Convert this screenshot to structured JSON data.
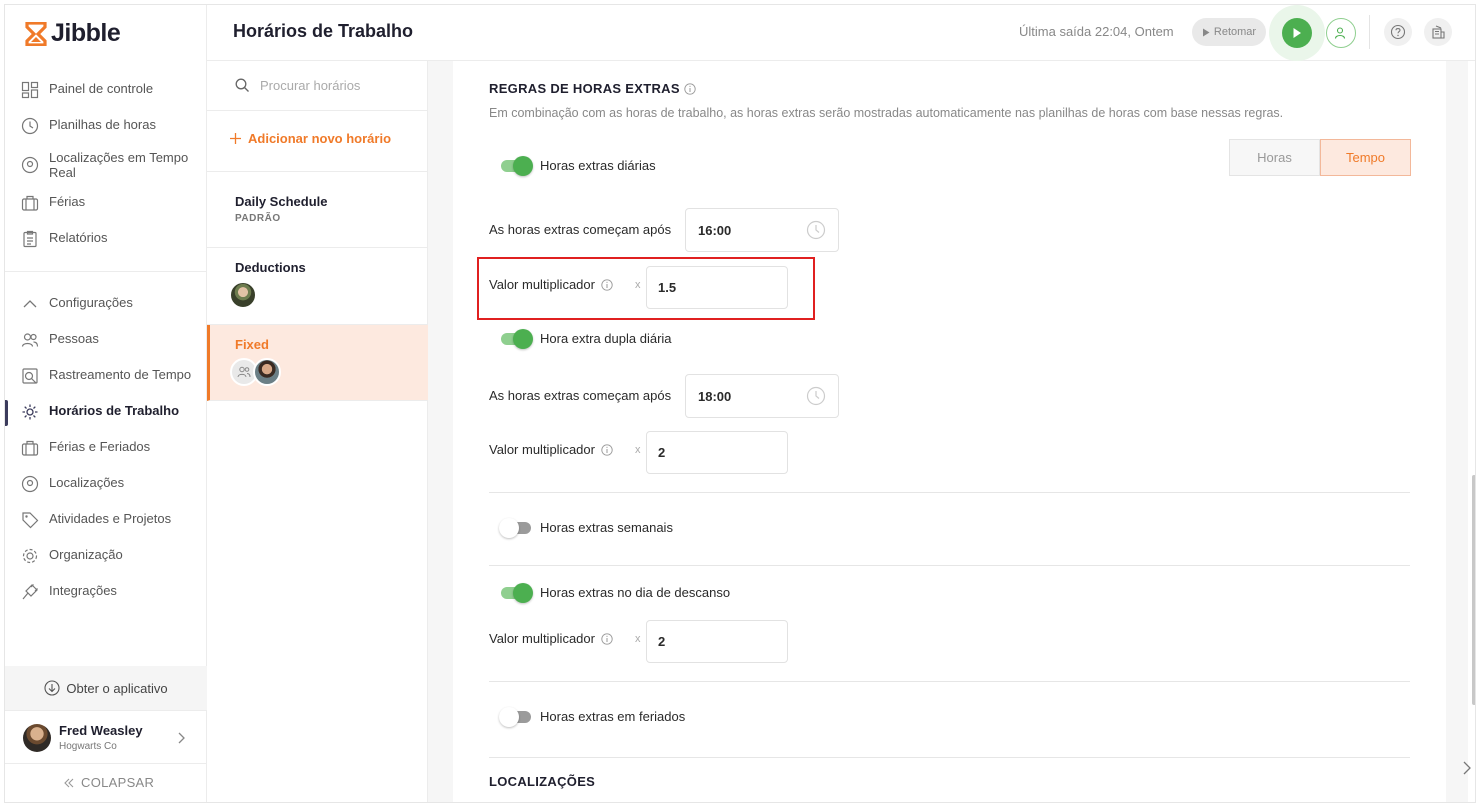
{
  "app": {
    "logo": "Jibble",
    "brand_color": "#f07a29",
    "accent_green": "#4caf50"
  },
  "sidebar": {
    "items": [
      {
        "label": "Painel de controle",
        "icon": "dashboard-icon"
      },
      {
        "label": "Planilhas de horas",
        "icon": "clock-icon"
      },
      {
        "label": "Localizações em Tempo Real",
        "icon": "location-pin-icon"
      },
      {
        "label": "Férias",
        "icon": "suitcase-icon"
      },
      {
        "label": "Relatórios",
        "icon": "clipboard-icon"
      }
    ],
    "settings_header": "Configurações",
    "settings_items": [
      {
        "label": "Pessoas",
        "icon": "people-icon"
      },
      {
        "label": "Rastreamento de Tempo",
        "icon": "time-tracking-icon"
      },
      {
        "label": "Horários de Trabalho",
        "icon": "schedule-gear-icon",
        "active": true
      },
      {
        "label": "Férias e Feriados",
        "icon": "suitcase-icon"
      },
      {
        "label": "Localizações",
        "icon": "location-pin-icon"
      },
      {
        "label": "Atividades e Projetos",
        "icon": "tag-icon"
      },
      {
        "label": "Organização",
        "icon": "gear-icon"
      },
      {
        "label": "Integrações",
        "icon": "plug-icon"
      }
    ],
    "get_app": "Obter o aplicativo",
    "user": {
      "name": "Fred Weasley",
      "org": "Hogwarts Co"
    },
    "collapse": "COLAPSAR"
  },
  "header": {
    "title": "Horários de Trabalho",
    "last_out": "Última saída 22:04, Ontem",
    "resume": "Retomar"
  },
  "schedules": {
    "search_placeholder": "Procurar horários",
    "add_new": "Adicionar novo horário",
    "items": [
      {
        "name": "Daily Schedule",
        "sub": "PADRÃO"
      },
      {
        "name": "Deductions"
      },
      {
        "name": "Fixed",
        "selected": true
      }
    ]
  },
  "overtime": {
    "title": "REGRAS DE HORAS EXTRAS",
    "description": "Em combinação com as horas de trabalho, as horas extras serão mostradas automaticamente nas planilhas de horas com base nessas regras.",
    "mode": {
      "options": [
        "Horas",
        "Tempo"
      ],
      "selected": "Tempo"
    },
    "daily": {
      "label": "Horas extras diárias",
      "enabled": true,
      "starts_after_label": "As horas extras começam após",
      "starts_after": "16:00",
      "multiplier_label": "Valor multiplicador",
      "multiplier": "1.5"
    },
    "daily_double": {
      "label": "Hora extra dupla diária",
      "enabled": true,
      "starts_after_label": "As horas extras começam após",
      "starts_after": "18:00",
      "multiplier_label": "Valor multiplicador",
      "multiplier": "2"
    },
    "weekly": {
      "label": "Horas extras semanais",
      "enabled": false
    },
    "rest_day": {
      "label": "Horas extras no dia de descanso",
      "enabled": true,
      "multiplier_label": "Valor multiplicador",
      "multiplier": "2"
    },
    "holidays": {
      "label": "Horas extras em feriados",
      "enabled": false
    },
    "x_symbol": "x"
  },
  "locations": {
    "title": "LOCALIZAÇÕES"
  }
}
